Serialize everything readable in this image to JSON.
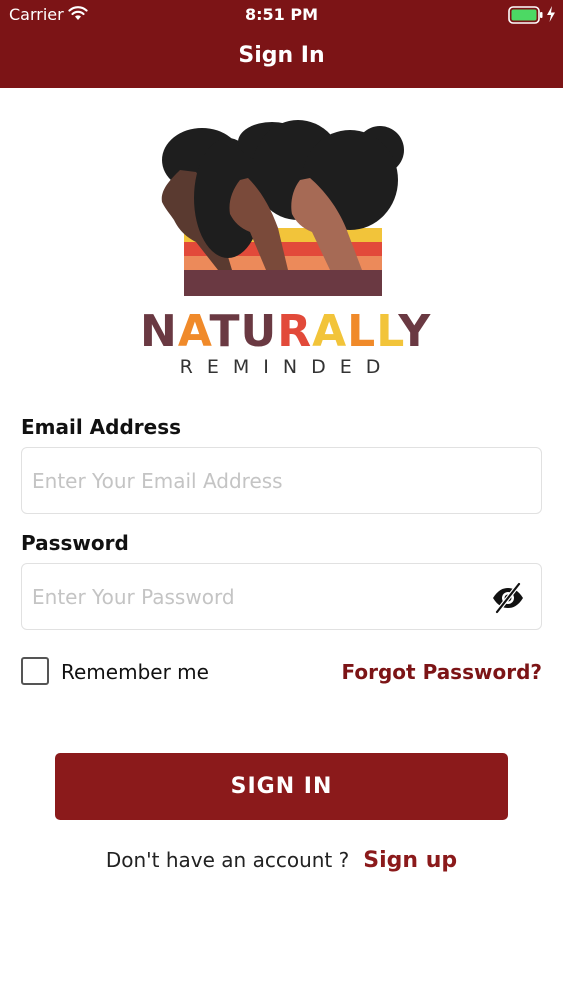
{
  "status_bar": {
    "carrier": "Carrier",
    "time": "8:51 PM",
    "wifi_icon": "wifi-icon",
    "battery_icon": "battery-full-charging-icon"
  },
  "header": {
    "title": "Sign In"
  },
  "logo": {
    "wordmark_parts": [
      "N",
      "A",
      "T",
      "U",
      "R",
      "A",
      "L",
      "L",
      "Y"
    ],
    "subtitle": "REMINDED",
    "colors": {
      "dark": "#6a3942",
      "orange": "#f08a2a",
      "yellow": "#f2c43a",
      "red": "#e24a3a",
      "hair": "#1e1e1e",
      "skin_dark": "#5a3a30",
      "skin_mid": "#7a4a3a",
      "skin_light": "#a66a55"
    }
  },
  "form": {
    "email": {
      "label": "Email Address",
      "placeholder": "Enter Your Email Address",
      "value": ""
    },
    "password": {
      "label": "Password",
      "placeholder": "Enter Your Password",
      "value": "",
      "toggle_icon": "eye-slash-icon"
    },
    "remember": {
      "label": "Remember me",
      "checked": false
    },
    "forgot_label": "Forgot Password?",
    "submit_label": "SIGN IN"
  },
  "signup": {
    "prompt": "Don't have an account ?",
    "link": "Sign up"
  },
  "colors": {
    "primary": "#7c1416",
    "button": "#8b1a1b"
  }
}
